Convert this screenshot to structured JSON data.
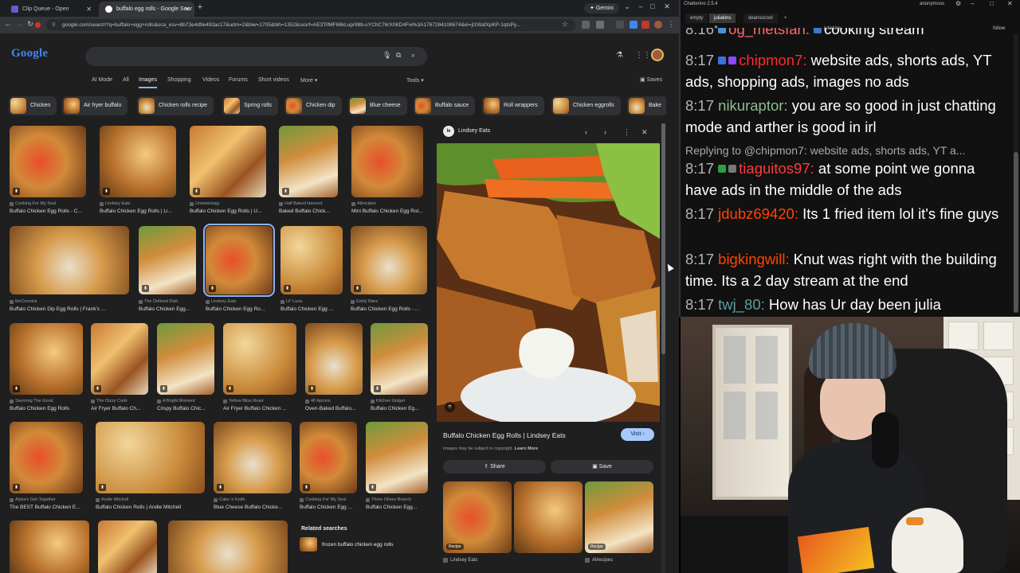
{
  "browser": {
    "tabs": [
      {
        "label": "Clip Queue - Open",
        "active": false
      },
      {
        "label": "buffalo egg rolls - Google Sear",
        "active": true
      }
    ],
    "new_tab": "+",
    "gemini_label": "Gemini",
    "url": "google.com/search?q=buffalo+egg+rolls&sca_esv=8b73e4d9e492ac17&udm=2&biw=1705&bih=1352&sxsrf=AE3TifMF68kLupr88b-uYChC76rX0KD4Fw%3A1767284108674&ei=jl1WafXpKP-1qtsPy..."
  },
  "google": {
    "logo": "Google",
    "search_value": "",
    "nav": [
      {
        "label": "AI Mode",
        "active": false
      },
      {
        "label": "All",
        "active": false
      },
      {
        "label": "Images",
        "active": true
      },
      {
        "label": "Shopping",
        "active": false
      },
      {
        "label": "Videos",
        "active": false
      },
      {
        "label": "Forums",
        "active": false
      },
      {
        "label": "Short videos",
        "active": false
      },
      {
        "label": "More ▾",
        "active": false
      }
    ],
    "tools": "Tools ▾",
    "saves": "Saves",
    "chips": [
      "Chicken",
      "Air fryer buffalo",
      "Chicken rolls recipe",
      "Spring rolls",
      "Chicken dip",
      "Blue cheese",
      "Buffalo sauce",
      "Roll wrappers",
      "Chicken eggrolls",
      "Bake"
    ],
    "results": [
      {
        "source": "Cooking For My Soul",
        "title": "Buffalo Chicken Egg Rolls - C..."
      },
      {
        "source": "Lindsey Eats",
        "title": "Buffalo Chicken Egg Rolls | Li..."
      },
      {
        "source": "Umamiology",
        "title": "Buffalo Chicken Egg Rolls | U..."
      },
      {
        "source": "Half Baked Harvest",
        "title": "Baked Buffalo Chick..."
      },
      {
        "source": "Allrecipes",
        "title": "Mini Buffalo Chicken Egg Rol..."
      },
      {
        "source": "McCormick",
        "title": "Buffalo Chicken Dip Egg Rolls | Frank's ..."
      },
      {
        "source": "The Defined Dish",
        "title": "Buffalo Chicken Egg..."
      },
      {
        "source": "Lindsey Eats",
        "title": "Buffalo Chicken Egg Ro..."
      },
      {
        "source": "Lil' Luna",
        "title": "Buffalo Chicken Egg ..."
      },
      {
        "source": "Emily Bites",
        "title": "Buffalo Chicken Egg Rolls - ..."
      },
      {
        "source": "Savoring The Good",
        "title": "Buffalo Chicken Egg Rolls"
      },
      {
        "source": "The Dizzy Cook",
        "title": "Air Fryer Buffalo Ch..."
      },
      {
        "source": "A Bright Moment",
        "title": "Crispy Buffalo Chic..."
      },
      {
        "source": "Yellow Bliss Road",
        "title": "Air Fryer Buffalo Chicken ..."
      },
      {
        "source": "40 Aprons",
        "title": "Oven-Baked Buffalo..."
      },
      {
        "source": "Kitchen Gidget",
        "title": "Buffalo Chicken Eg..."
      },
      {
        "source": "Alyka's Get-Together",
        "title": "The BEST Buffalo Chicken E..."
      },
      {
        "source": "Andie Mitchell",
        "title": "Buffalo Chicken Rolls | Andie Mitchell"
      },
      {
        "source": "Cake 'n Knife",
        "title": "Blue Cheese Buffalo Chicke..."
      },
      {
        "source": "Cooking For My Soul",
        "title": "Buffalo Chicken Egg ..."
      },
      {
        "source": "Three Olives Branch",
        "title": "Buffalo Chicken Egg..."
      }
    ],
    "related": {
      "heading": "Related searches",
      "item": "frozen buffalo chicken egg rolls"
    },
    "preview": {
      "source": "Lindsey Eats",
      "title": "Buffalo Chicken Egg Rolls | Lindsey Eats",
      "visit": "Visit ›",
      "copyright": "Images may be subject to copyright.",
      "learn_more": "Learn More",
      "share": "Share",
      "save": "Save",
      "thumbs": [
        {
          "badge": "Recipe",
          "source": "Lindsey Eats"
        },
        {
          "badge": "",
          "source": ""
        },
        {
          "badge": "Recipe",
          "source": "Allrecipes"
        }
      ]
    }
  },
  "chat": {
    "app_title": "Chatterino 2.5.4",
    "account": "anonymous",
    "tabs": [
      {
        "label": "empty",
        "active": false
      },
      {
        "label": "juliakins",
        "active": true
      },
      {
        "label": "deansocool",
        "active": false
      }
    ],
    "channel": "juliakins",
    "follow": "follow",
    "messages": [
      {
        "time": "8:16",
        "user": "og_metsfan:",
        "color": "#ff6b6b",
        "text": "cooking stream",
        "reply": ""
      },
      {
        "time": "8:17",
        "user": "chipmon7:",
        "color": "#ff2a2a",
        "text": "website ads, shorts ads, YT ads, shopping ads, images no ads",
        "reply": ""
      },
      {
        "time": "8:17",
        "user": "nikuraptor:",
        "color": "#8fbc8f",
        "text": "you are so good in just chatting mode and arther is good in irl",
        "reply": ""
      },
      {
        "time": "",
        "user": "",
        "color": "#ff2a2a",
        "text": "",
        "reply": "Replying to @chipmon7: website ads, shorts ads, YT a..."
      },
      {
        "time": "8:17",
        "user": "tiaguitos97:",
        "color": "#ff3b3b",
        "text": "at some point we gonna have ads in the middle of the ads",
        "reply": ""
      },
      {
        "time": "8:17",
        "user": "jdubz69420:",
        "color": "#ff4500",
        "text": "Its 1 fried item lol it's fine guys",
        "reply": ""
      },
      {
        "time": "8:17",
        "user": "bigkingwill:",
        "color": "#ff4500",
        "text": "Knut was right with the building time. Its a 2 day stream at the end",
        "reply": ""
      },
      {
        "time": "8:17",
        "user": "twj_80:",
        "color": "#5f9ea0",
        "text": "How has Ur day been julia",
        "reply": ""
      }
    ]
  }
}
